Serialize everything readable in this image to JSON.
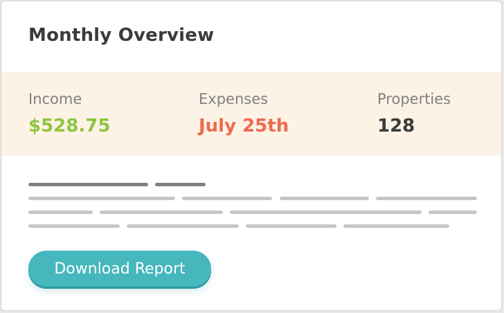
{
  "header": {
    "title": "Monthly Overview"
  },
  "stats": [
    {
      "label": "Income",
      "value": "$528.75",
      "color": "#8cc63f"
    },
    {
      "label": "Expenses",
      "value": "July 25th",
      "color": "#ef6a4f"
    },
    {
      "label": "Properties",
      "value": "128",
      "color": "#3b3b3b"
    }
  ],
  "colors": {
    "stats_background": "#fdf2e6",
    "button": "#45b7bd",
    "placeholder_dark": "#808080",
    "placeholder_light": "#c6c6c6"
  },
  "actions": {
    "download_label": "Download Report"
  }
}
